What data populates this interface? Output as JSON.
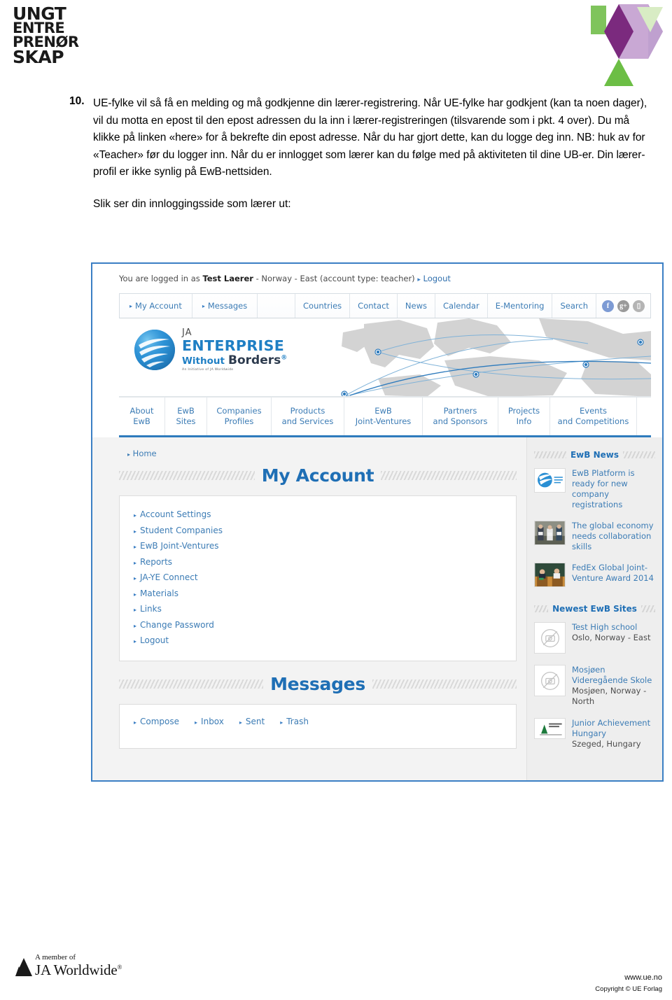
{
  "header": {
    "org_logo_lines": [
      "UNGT",
      "ENTRE",
      "PRENØR",
      "SKAP"
    ],
    "hex_logo_name": "ungt-entreprenorskap-hexagon-logo"
  },
  "document": {
    "item_number": "10.",
    "paragraph": "UE-fylke vil så få en melding og må godkjenne din lærer-registrering. Når UE-fylke har godkjent (kan ta noen dager), vil du motta en epost til den epost adressen du la inn i lærer-registreringen (tilsvarende som i pkt. 4 over). Du må klikke på linken «here» for å bekrefte din epost adresse. Når du har gjort dette, kan du logge deg inn. NB: huk av for «Teacher» før du logger inn. Når du er innlogget som lærer kan du følge med på aktiviteten til dine UB-er. Din lærer-profil er ikke synlig på EwB-nettsiden.",
    "caption": "Slik ser din innloggingsside som lærer ut:"
  },
  "screenshot": {
    "login_strip": {
      "prefix": "You are logged in as",
      "user": "Test Laerer",
      "suffix": "- Norway - East (account type: teacher)",
      "logout": "Logout"
    },
    "topnav": {
      "left_items": [
        {
          "label": "My Account",
          "arrow": true
        },
        {
          "label": "Messages",
          "arrow": true
        }
      ],
      "right_items": [
        {
          "label": "Countries"
        },
        {
          "label": "Contact"
        },
        {
          "label": "News"
        },
        {
          "label": "Calendar"
        },
        {
          "label": "E-Mentoring"
        },
        {
          "label": "Search"
        }
      ],
      "social": [
        {
          "name": "facebook-icon",
          "glyph": "f",
          "color": "#7d9bd4"
        },
        {
          "name": "google-plus-icon",
          "glyph": "g+",
          "color": "#9a9a9a"
        },
        {
          "name": "youtube-icon",
          "glyph": "▭",
          "color": "#b4b4b4"
        }
      ]
    },
    "brand": {
      "line1": "JA",
      "line2": "ENTERPRISE",
      "line3_a": "Without",
      "line3_b": "Borders",
      "registered": "®",
      "tagline": "An Initiative of JA Worldwide"
    },
    "sectionnav": [
      {
        "l1": "About",
        "l2": "EwB"
      },
      {
        "l1": "EwB",
        "l2": "Sites"
      },
      {
        "l1": "Companies",
        "l2": "Profiles"
      },
      {
        "l1": "Products",
        "l2": "and Services"
      },
      {
        "l1": "EwB",
        "l2": "Joint-Ventures"
      },
      {
        "l1": "Partners",
        "l2": "and Sponsors"
      },
      {
        "l1": "Projects",
        "l2": "Info"
      },
      {
        "l1": "Events",
        "l2": "and Competitions"
      }
    ],
    "breadcrumb": "Home",
    "my_account": {
      "title": "My Account",
      "items": [
        "Account Settings",
        "Student Companies",
        "EwB Joint-Ventures",
        "Reports",
        "JA-YE Connect",
        "Materials",
        "Links",
        "Change Password",
        "Logout"
      ]
    },
    "messages": {
      "title": "Messages",
      "items": [
        "Compose",
        "Inbox",
        "Sent",
        "Trash"
      ]
    },
    "news": {
      "title": "EwB News",
      "items": [
        {
          "text": "EwB Platform is ready for new company registrations",
          "thumb": "ewb-logo-thumbnail"
        },
        {
          "text": "The global economy needs collaboration skills",
          "thumb": "award-ceremony-photo"
        },
        {
          "text": "FedEx Global Joint-Venture Award 2014",
          "thumb": "conference-podium-photo"
        }
      ]
    },
    "newest_sites": {
      "title": "Newest EwB Sites",
      "items": [
        {
          "name": "Test High school",
          "location": "Oslo, Norway - East",
          "thumb": "no-image-placeholder"
        },
        {
          "name": "Mosjøen Videregående Skole",
          "location": "Mosjøen, Norway - North",
          "thumb": "no-image-placeholder"
        },
        {
          "name": "Junior Achievement Hungary",
          "location": "Szeged, Hungary",
          "thumb": "ja-hungary-logo"
        }
      ]
    }
  },
  "footer": {
    "member_line1": "A member of",
    "member_line2": "JA Worldwide",
    "registered": "®",
    "website": "www.ue.no",
    "copyright": "Copyright © UE Forlag"
  },
  "colors": {
    "brand_blue": "#1f6fb5",
    "link_blue": "#3c7cb5",
    "nav_underline": "#2e7bbd",
    "hex_purple": "#7b2a7e",
    "hex_green": "#6cbe45"
  }
}
